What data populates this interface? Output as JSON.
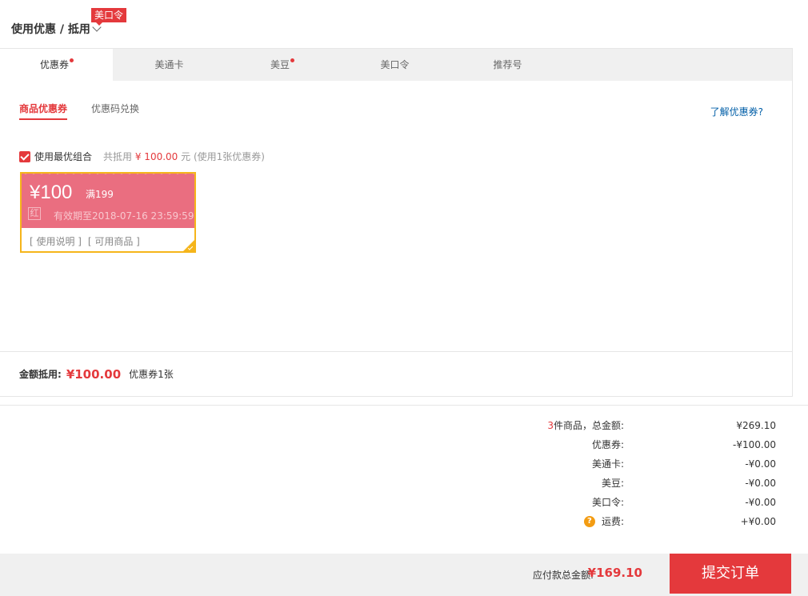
{
  "header": {
    "title": "使用优惠 / 抵用",
    "promo_tag": "美口令"
  },
  "tabs": [
    {
      "label": "优惠券",
      "dot": true
    },
    {
      "label": "美通卡",
      "dot": false
    },
    {
      "label": "美豆",
      "dot": true
    },
    {
      "label": "美口令",
      "dot": false
    },
    {
      "label": "推荐号",
      "dot": false
    }
  ],
  "subtabs": {
    "goods_coupon": "商品优惠券",
    "code_exchange": "优惠码兑换"
  },
  "learn_link": "了解优惠券?",
  "best_combo": {
    "label": "使用最优组合",
    "note_prefix": "共抵用",
    "note_amount": "¥ 100.00",
    "note_unit": "元",
    "note_suffix": "(使用1张优惠券)"
  },
  "coupon": {
    "price": "¥100",
    "limit": "满199",
    "type": "红",
    "expiry": "有效期至2018-07-16 23:59:59",
    "usage_link": "[ 使用说明 ]",
    "goods_link": "[ 可用商品 ]"
  },
  "panel_footer": {
    "label": "金额抵用:",
    "amount": "¥100.00",
    "count": "优惠券1张"
  },
  "summary": {
    "items_count": "3",
    "items_label": "件商品，总金额:",
    "items_value": "¥269.10",
    "rows": [
      {
        "label": "优惠券:",
        "value": "-¥100.00"
      },
      {
        "label": "美通卡:",
        "value": "-¥0.00"
      },
      {
        "label": "美豆:",
        "value": "-¥0.00"
      },
      {
        "label": "美口令:",
        "value": "-¥0.00"
      }
    ],
    "shipping_label": "运费:",
    "shipping_value": "+¥0.00",
    "help_icon": "?"
  },
  "bottom": {
    "total_label": "应付款总金额:",
    "total_value": "¥169.10",
    "submit_label": "提交订单"
  },
  "colors": {
    "accent": "#e4393c",
    "coupon_bg": "#ea6e80",
    "coupon_border": "#f5b51b",
    "link": "#005ea7"
  }
}
